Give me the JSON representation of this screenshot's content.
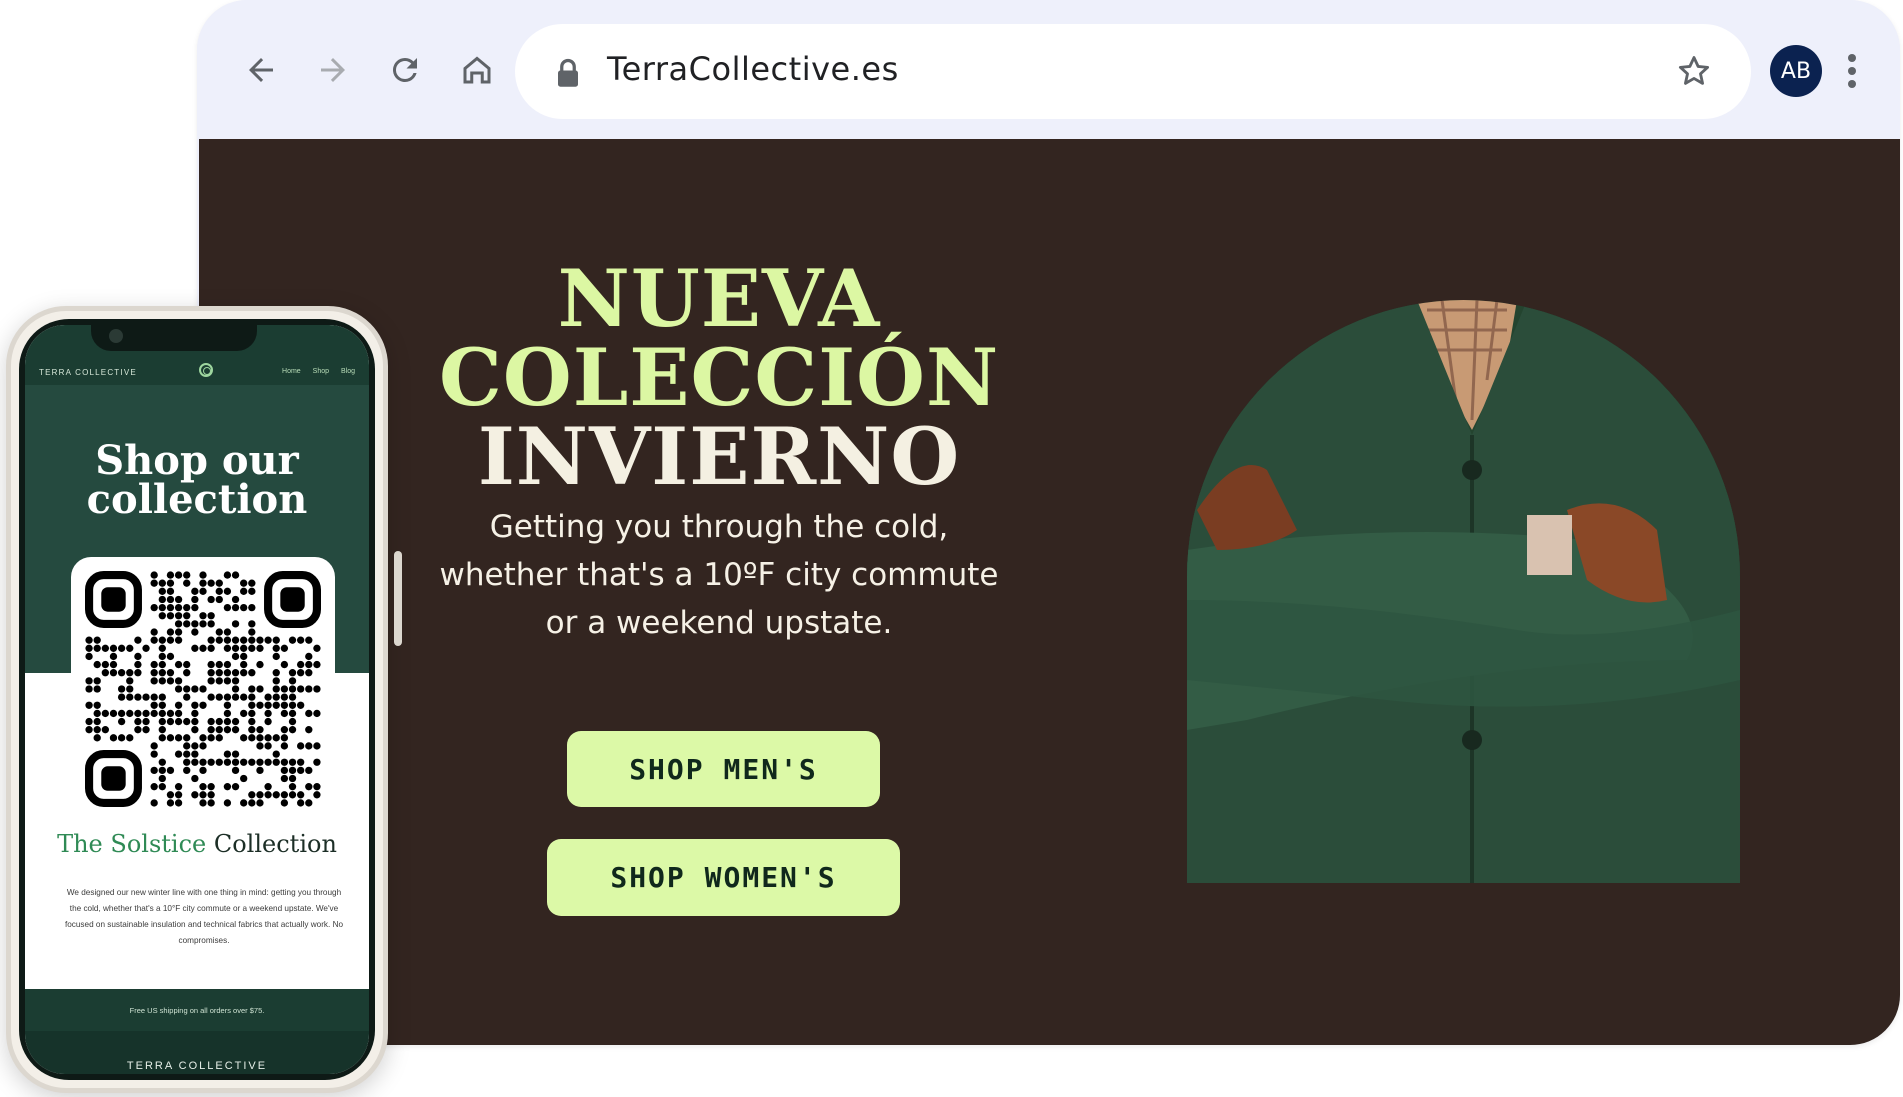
{
  "browser": {
    "url": "TerraCollective.es",
    "profile_initials": "AB",
    "icons": [
      "back-icon",
      "forward-icon",
      "reload-icon",
      "home-icon",
      "lock-icon",
      "bookmark-star-icon",
      "more-vertical-icon"
    ]
  },
  "hero": {
    "title_line1": "NUEVA",
    "title_line2": "COLECCIÓN",
    "title_line3": "INVIERNO",
    "subtitle": "Getting you through the cold, whether that's a 10ºF city commute or a weekend upstate.",
    "cta_men": "SHOP MEN'S",
    "cta_women": "SHOP WOMEN'S"
  },
  "mobile": {
    "brand": "TERRA COLLECTIVE",
    "nav": [
      "Home",
      "Shop",
      "Blog"
    ],
    "heading": "Shop our collection",
    "subheading_accent": "The Solstice",
    "subheading_rest": " Collection",
    "body": "We designed our new winter line with one thing in mind: getting you through the cold, whether that's a 10°F city commute or a weekend upstate. We've focused on sustainable insulation and technical fabrics that actually work. No compromises.",
    "shipping": "Free US shipping on all orders over $75.",
    "footer": "TERRA COLLECTIVE"
  },
  "colors": {
    "hero_bg": "#332520",
    "accent_lime": "#dcf9a7",
    "browser_chrome": "#eef0fb",
    "mobile_green": "#254a3f",
    "avatar_bg": "#0b2250"
  }
}
